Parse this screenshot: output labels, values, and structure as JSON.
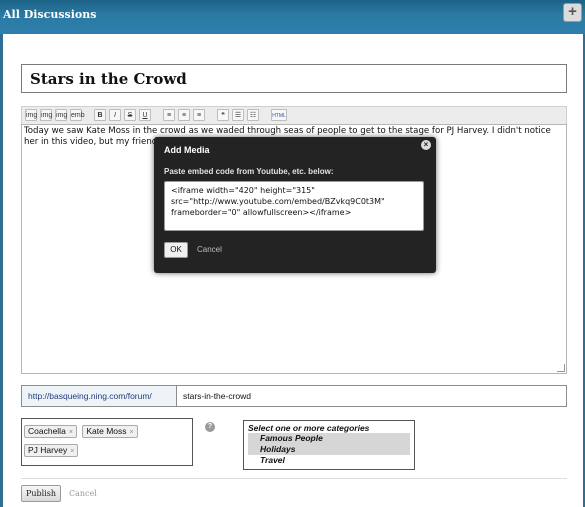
{
  "header": {
    "title": "All Discussions",
    "plus_label": "+"
  },
  "post": {
    "title": "Stars in the Crowd",
    "body": "Today we saw Kate Moss in the crowd as we waded through seas of people to get to the stage for PJ Harvey. I didn't notice her in this video, but my friend swe"
  },
  "toolbar": {
    "buttons": [
      "img",
      "img",
      "img",
      "emb",
      "B",
      "I",
      "S",
      "U",
      "≡",
      "≡",
      "≡",
      "❝",
      "☰",
      "☷",
      "HTML"
    ]
  },
  "modal": {
    "title": "Add Media",
    "close": "×",
    "instruction": "Paste embed code from Youtube, etc. below:",
    "code": "<iframe width=\"420\" height=\"315\"\nsrc=\"http://www.youtube.com/embed/BZvkq9C0t3M\"\nframeborder=\"0\" allowfullscreen></iframe>",
    "ok_label": "OK",
    "cancel_label": "Cancel"
  },
  "url": {
    "prefix": "http://basqueing.ning.com/forum/",
    "slug": "stars-in-the-crowd"
  },
  "tags": [
    {
      "label": "Coachella"
    },
    {
      "label": "Kate Moss"
    },
    {
      "label": "PJ Harvey"
    }
  ],
  "tag_remove_glyph": "×",
  "help_glyph": "?",
  "categories": {
    "heading": "Select one or more categories",
    "options": [
      {
        "label": "Famous People",
        "selected": true
      },
      {
        "label": "Holidays",
        "selected": true
      },
      {
        "label": "Travel",
        "selected": false
      }
    ]
  },
  "actions": {
    "publish_label": "Publish",
    "cancel_label": "Cancel"
  }
}
